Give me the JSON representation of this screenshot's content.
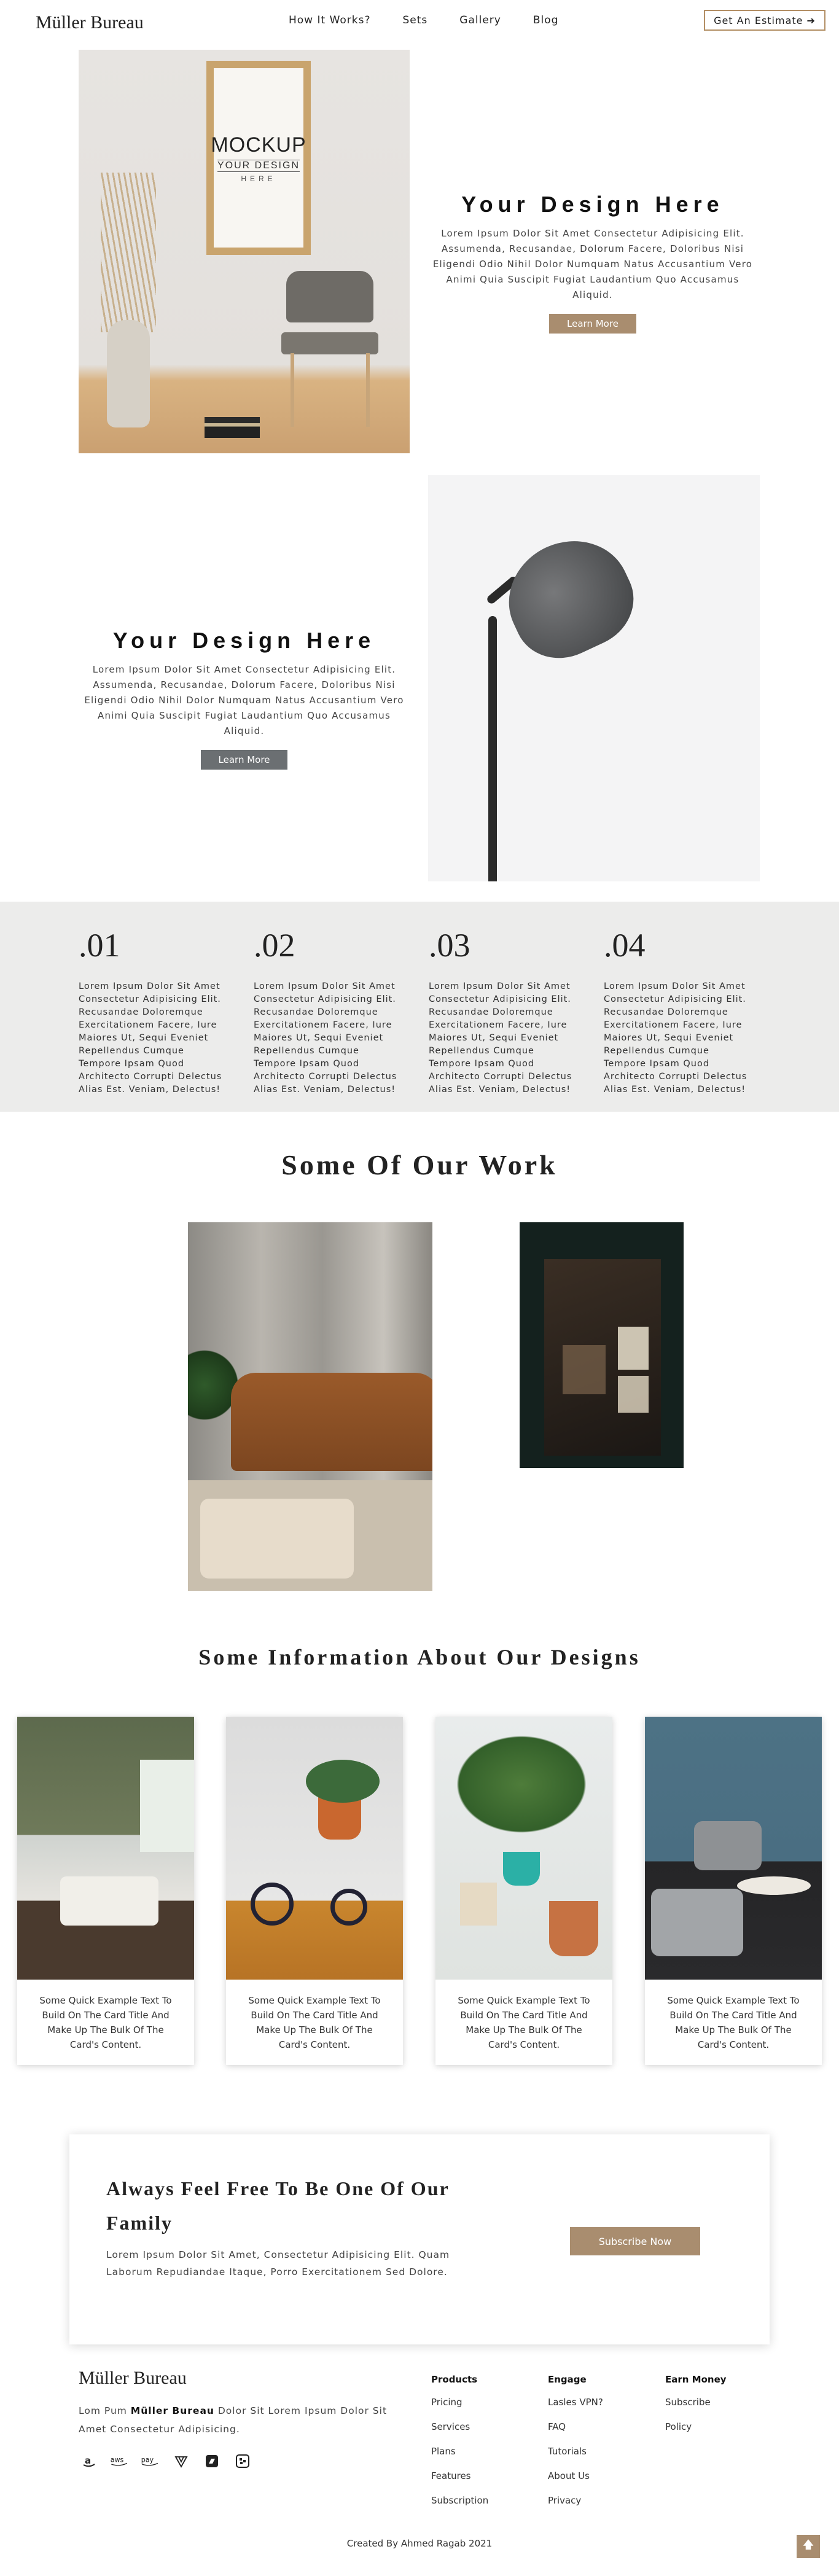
{
  "nav": {
    "logo": "Müller Bureau",
    "links": [
      "How It Works?",
      "Sets",
      "Gallery",
      "Blog"
    ],
    "estimate_label": "Get An Estimate",
    "estimate_icon": "arrow-right-icon"
  },
  "hero1": {
    "mockup_line1": "MOCKUP",
    "mockup_line2": "YOUR DESIGN",
    "mockup_line3": "HERE",
    "title": "Your Design Here",
    "body": "Lorem Ipsum Dolor Sit Amet Consectetur Adipisicing Elit. Assumenda, Recusandae, Dolorum Facere, Doloribus Nisi Eligendi Odio Nihil Dolor Numquam Natus Accusantium Vero Animi Quia Suscipit Fugiat Laudantium Quo Accusamus Aliquid.",
    "button": "Learn More"
  },
  "hero2": {
    "title": "Your Design Here",
    "body": "Lorem Ipsum Dolor Sit Amet Consectetur Adipisicing Elit. Assumenda, Recusandae, Dolorum Facere, Doloribus Nisi Eligendi Odio Nihil Dolor Numquam Natus Accusantium Vero Animi Quia Suscipit Fugiat Laudantium Quo Accusamus Aliquid.",
    "button": "Learn More"
  },
  "features": [
    {
      "num": ".01",
      "text": "Lorem Ipsum Dolor Sit Amet Consectetur Adipisicing Elit. Recusandae Doloremque Exercitationem Facere, Iure Maiores Ut, Sequi Eveniet Repellendus Cumque Tempore Ipsam Quod Architecto Corrupti Delectus Alias Est. Veniam, Delectus!"
    },
    {
      "num": ".02",
      "text": "Lorem Ipsum Dolor Sit Amet Consectetur Adipisicing Elit. Recusandae Doloremque Exercitationem Facere, Iure Maiores Ut, Sequi Eveniet Repellendus Cumque Tempore Ipsam Quod Architecto Corrupti Delectus Alias Est. Veniam, Delectus!"
    },
    {
      "num": ".03",
      "text": "Lorem Ipsum Dolor Sit Amet Consectetur Adipisicing Elit. Recusandae Doloremque Exercitationem Facere, Iure Maiores Ut, Sequi Eveniet Repellendus Cumque Tempore Ipsam Quod Architecto Corrupti Delectus Alias Est. Veniam, Delectus!"
    },
    {
      "num": ".04",
      "text": "Lorem Ipsum Dolor Sit Amet Consectetur Adipisicing Elit. Recusandae Doloremque Exercitationem Facere, Iure Maiores Ut, Sequi Eveniet Repellendus Cumque Tempore Ipsam Quod Architecto Corrupti Delectus Alias Est. Veniam, Delectus!"
    }
  ],
  "work": {
    "title": "Some Of Our Work"
  },
  "info": {
    "title": "Some Information About Our Designs",
    "cards": [
      {
        "text": "Some Quick Example Text To Build On The Card Title And Make Up The Bulk Of The Card's Content."
      },
      {
        "text": "Some Quick Example Text To Build On The Card Title And Make Up The Bulk Of The Card's Content."
      },
      {
        "text": "Some Quick Example Text To Build On The Card Title And Make Up The Bulk Of The Card's Content."
      },
      {
        "text": "Some Quick Example Text To Build On The Card Title And Make Up The Bulk Of The Card's Content."
      }
    ]
  },
  "cta": {
    "title": "Always Feel Free To Be One Of Our Family",
    "body": "Lorem Ipsum Dolor Sit Amet, Consectetur Adipisicing Elit. Quam Laborum Repudiandae Itaque, Porro Exercitationem Sed Dolore.",
    "button": "Subscribe Now"
  },
  "footer": {
    "logo": "Müller Bureau",
    "desc_prefix": "Lom Pum ",
    "desc_brand": "Müller Bureau",
    "desc_suffix": " Dolor Sit Lorem Ipsum Dolor Sit Amet Consectetur Adipisicing.",
    "socials": [
      "amazon-icon",
      "aws-icon",
      "amazon-pay-icon",
      "vuetify-icon",
      "bandcamp-icon",
      "dropbox-icon"
    ],
    "columns": [
      {
        "head": "Products",
        "items": [
          "Pricing",
          "Services",
          "Plans",
          "Features",
          "Subscription"
        ]
      },
      {
        "head": "Engage",
        "items": [
          "Lasles VPN?",
          "FAQ",
          "Tutorials",
          "About Us",
          "Privacy"
        ]
      },
      {
        "head": "Earn Money",
        "items": [
          "Subscribe",
          "Policy"
        ]
      }
    ],
    "credit": "Created By Ahmed Ragab 2021",
    "top_icon": "arrow-up-icon"
  },
  "colors": {
    "accent": "#a98d6f",
    "accent_border": "#b38f65",
    "features_bg": "#ececeb",
    "gray_button": "#6b6f72"
  }
}
